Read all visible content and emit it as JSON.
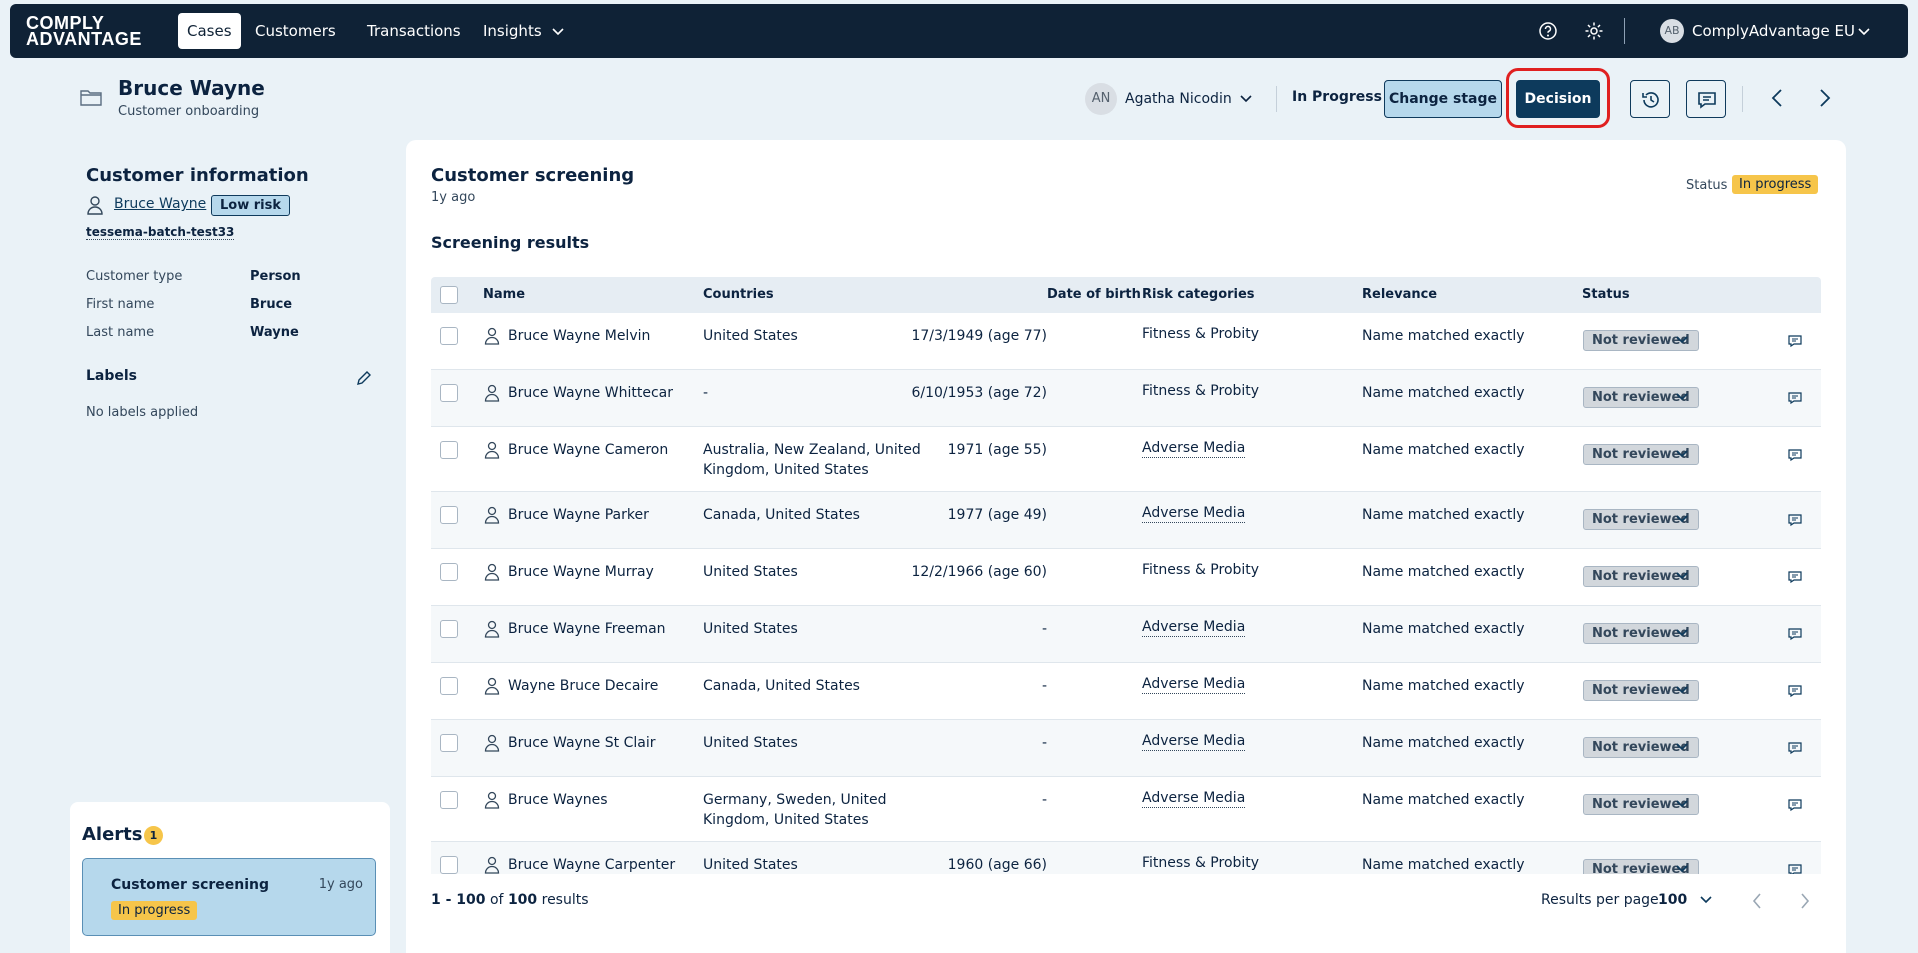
{
  "nav": {
    "logo_line1": "COMPLY",
    "logo_line2": "ADVANTAGE",
    "tabs": [
      {
        "label": "Cases",
        "active": true
      },
      {
        "label": "Customers"
      },
      {
        "label": "Transactions"
      },
      {
        "label": "Insights"
      }
    ],
    "account_initials": "AB",
    "account_name": "ComplyAdvantage EU"
  },
  "case_header": {
    "name": "Bruce Wayne",
    "subtitle": "Customer onboarding",
    "assignee_initials": "AN",
    "assignee_name": "Agatha Nicodin",
    "stage": "In Progress",
    "change_stage_label": "Change stage",
    "decision_label": "Decision"
  },
  "customer_info": {
    "title": "Customer information",
    "name_link": "Bruce Wayne",
    "risk": "Low risk",
    "identifier": "tessema-batch-test33",
    "fields": [
      {
        "label": "Customer type",
        "value": "Person"
      },
      {
        "label": "First name",
        "value": "Bruce"
      },
      {
        "label": "Last name",
        "value": "Wayne"
      }
    ],
    "labels_title": "Labels",
    "labels_empty": "No labels applied"
  },
  "alerts": {
    "title": "Alerts",
    "count": "1",
    "items": [
      {
        "title": "Customer screening",
        "time": "1y ago",
        "status": "In progress"
      }
    ]
  },
  "screening": {
    "title": "Customer screening",
    "time": "1y ago",
    "status_label": "Status",
    "status": "In progress",
    "results_title": "Screening results",
    "columns": [
      "Name",
      "Countries",
      "Date of birth",
      "Risk categories",
      "Relevance",
      "Status"
    ],
    "rows": [
      {
        "name": "Bruce Wayne Melvin",
        "countries": [
          "United States"
        ],
        "dob": "17/3/1949 (age 77)",
        "category": "Fitness & Probity",
        "relevance": "Name matched exactly",
        "status": "Not reviewed"
      },
      {
        "name": "Bruce Wayne Whittecar",
        "countries": [
          "-"
        ],
        "dob": "6/10/1953 (age 72)",
        "category": "Fitness & Probity",
        "relevance": "Name matched exactly",
        "status": "Not reviewed"
      },
      {
        "name": "Bruce Wayne Cameron",
        "countries": [
          "Australia, New Zealand, United",
          "Kingdom, United States"
        ],
        "dob": "1971 (age 55)",
        "category": "Adverse Media",
        "relevance": "Name matched exactly",
        "status": "Not reviewed"
      },
      {
        "name": "Bruce Wayne Parker",
        "countries": [
          "Canada, United States"
        ],
        "dob": "1977 (age 49)",
        "category": "Adverse Media",
        "relevance": "Name matched exactly",
        "status": "Not reviewed"
      },
      {
        "name": "Bruce Wayne Murray",
        "countries": [
          "United States"
        ],
        "dob": "12/2/1966 (age 60)",
        "category": "Fitness & Probity",
        "relevance": "Name matched exactly",
        "status": "Not reviewed"
      },
      {
        "name": "Bruce Wayne Freeman",
        "countries": [
          "United States"
        ],
        "dob": "-",
        "category": "Adverse Media",
        "relevance": "Name matched exactly",
        "status": "Not reviewed"
      },
      {
        "name": "Wayne Bruce Decaire",
        "countries": [
          "Canada, United States"
        ],
        "dob": "-",
        "category": "Adverse Media",
        "relevance": "Name matched exactly",
        "status": "Not reviewed"
      },
      {
        "name": "Bruce Wayne St Clair",
        "countries": [
          "United States"
        ],
        "dob": "-",
        "category": "Adverse Media",
        "relevance": "Name matched exactly",
        "status": "Not reviewed"
      },
      {
        "name": "Bruce Waynes",
        "countries": [
          "Germany, Sweden, United",
          "Kingdom, United States"
        ],
        "dob": "-",
        "category": "Adverse Media",
        "relevance": "Name matched exactly",
        "status": "Not reviewed"
      },
      {
        "name": "Bruce Wayne Carpenter",
        "countries": [
          "United States"
        ],
        "dob": "1960 (age 66)",
        "category": "Fitness & Probity",
        "relevance": "Name matched exactly",
        "status": "Not reviewed"
      }
    ],
    "pager_range": "1 - 100",
    "pager_of": "of",
    "pager_total": "100",
    "pager_suffix": "results",
    "results_per_page_label": "Results per page",
    "results_per_page": "100"
  }
}
